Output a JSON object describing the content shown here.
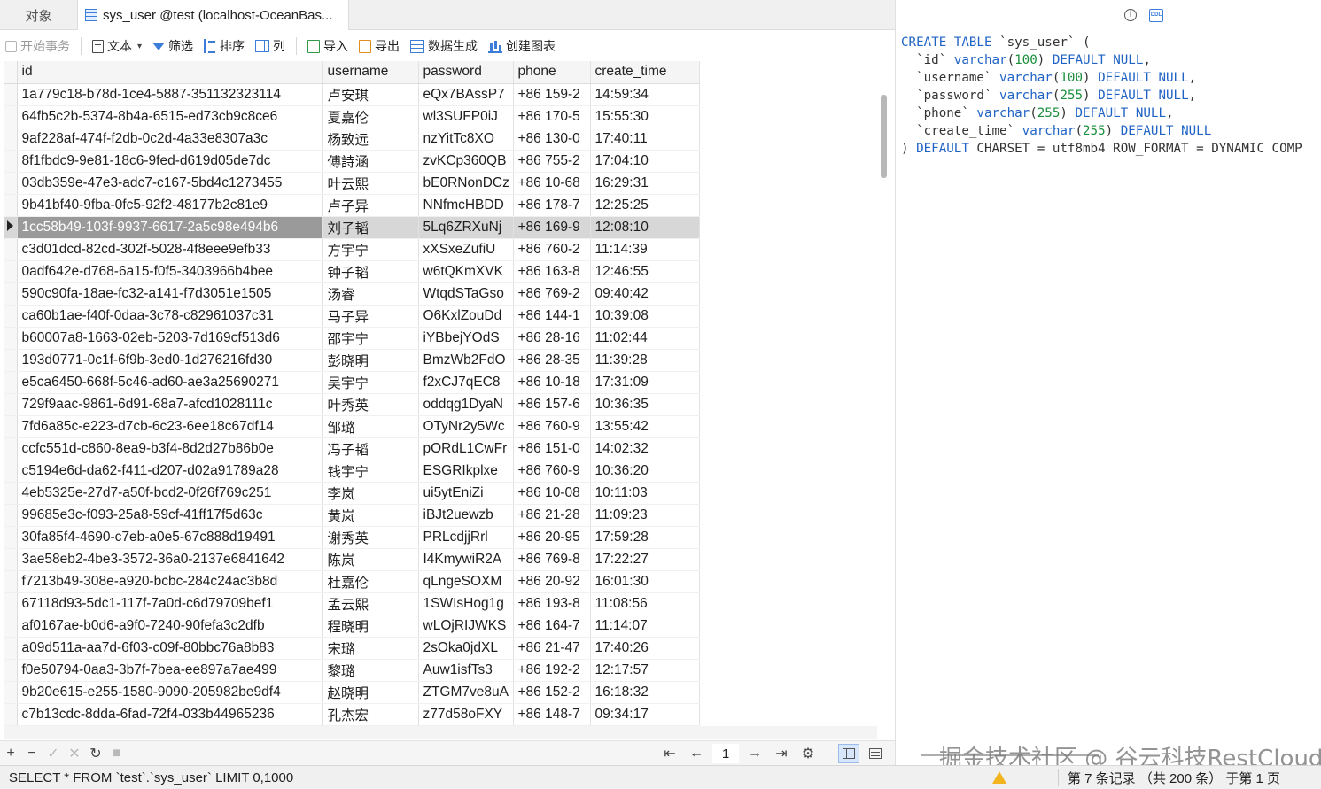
{
  "tabs": {
    "objects": "对象",
    "active": "sys_user @test (localhost-OceanBas..."
  },
  "toolbar": {
    "begin_transaction": "开始事务",
    "text": "文本",
    "filter": "筛选",
    "sort": "排序",
    "column": "列",
    "import": "导入",
    "export": "导出",
    "data_generation": "数据生成",
    "create_chart": "创建图表"
  },
  "grid": {
    "columns": [
      "id",
      "username",
      "password",
      "phone",
      "create_time"
    ],
    "selected_row_index": 6,
    "rows": [
      [
        "1a779c18-b78d-1ce4-5887-351132323114",
        "卢安琪",
        "eQx7BAssP7",
        "+86 159-2",
        "14:59:34"
      ],
      [
        "64fb5c2b-5374-8b4a-6515-ed73cb9c8ce6",
        "夏嘉伦",
        "wl3SUFP0iJ",
        "+86 170-5",
        "15:55:30"
      ],
      [
        "9af228af-474f-f2db-0c2d-4a33e8307a3c",
        "杨致远",
        "nzYitTc8XO",
        "+86 130-0",
        "17:40:11"
      ],
      [
        "8f1fbdc9-9e81-18c6-9fed-d619d05de7dc",
        "傅詩涵",
        "zvKCp360QB",
        "+86 755-2",
        "17:04:10"
      ],
      [
        "03db359e-47e3-adc7-c167-5bd4c1273455",
        "叶云熙",
        "bE0RNonDCz",
        "+86 10-68",
        "16:29:31"
      ],
      [
        "9b41bf40-9fba-0fc5-92f2-48177b2c81e9",
        "卢子异",
        "NNfmcHBDD",
        "+86 178-7",
        "12:25:25"
      ],
      [
        "1cc58b49-103f-9937-6617-2a5c98e494b6",
        "刘子韬",
        "5Lq6ZRXuNj",
        "+86 169-9",
        "12:08:10"
      ],
      [
        "c3d01dcd-82cd-302f-5028-4f8eee9efb33",
        "方宇宁",
        "xXSxeZufiU",
        "+86 760-2",
        "11:14:39"
      ],
      [
        "0adf642e-d768-6a15-f0f5-3403966b4bee",
        "钟子韬",
        "w6tQKmXVK",
        "+86 163-8",
        "12:46:55"
      ],
      [
        "590c90fa-18ae-fc32-a141-f7d3051e1505",
        "汤睿",
        "WtqdSTaGso",
        "+86 769-2",
        "09:40:42"
      ],
      [
        "ca60b1ae-f40f-0daa-3c78-c82961037c31",
        "马子异",
        "O6KxlZouDd",
        "+86 144-1",
        "10:39:08"
      ],
      [
        "b60007a8-1663-02eb-5203-7d169cf513d6",
        "邵宇宁",
        "iYBbejYOdS",
        "+86 28-16",
        "11:02:44"
      ],
      [
        "193d0771-0c1f-6f9b-3ed0-1d276216fd30",
        "彭晓明",
        "BmzWb2FdO",
        "+86 28-35",
        "11:39:28"
      ],
      [
        "e5ca6450-668f-5c46-ad60-ae3a25690271",
        "吴宇宁",
        "f2xCJ7qEC8",
        "+86 10-18",
        "17:31:09"
      ],
      [
        "729f9aac-9861-6d91-68a7-afcd1028111c",
        "叶秀英",
        "oddqg1DyaN",
        "+86 157-6",
        "10:36:35"
      ],
      [
        "7fd6a85c-e223-d7cb-6c23-6ee18c67df14",
        "邹璐",
        "OTyNr2y5Wc",
        "+86 760-9",
        "13:55:42"
      ],
      [
        "ccfc551d-c860-8ea9-b3f4-8d2d27b86b0e",
        "冯子韬",
        "pORdL1CwFr",
        "+86 151-0",
        "14:02:32"
      ],
      [
        "c5194e6d-da62-f411-d207-d02a91789a28",
        "钱宇宁",
        "ESGRIkplxe",
        "+86 760-9",
        "10:36:20"
      ],
      [
        "4eb5325e-27d7-a50f-bcd2-0f26f769c251",
        "李岚",
        "ui5ytEniZi",
        "+86 10-08",
        "10:11:03"
      ],
      [
        "99685e3c-f093-25a8-59cf-41ff17f5d63c",
        "黄岚",
        "iBJt2uewzb",
        "+86 21-28",
        "11:09:23"
      ],
      [
        "30fa85f4-4690-c7eb-a0e5-67c888d19491",
        "谢秀英",
        "PRLcdjjRrl",
        "+86 20-95",
        "17:59:28"
      ],
      [
        "3ae58eb2-4be3-3572-36a0-2137e6841642",
        "陈岚",
        "I4KmywiR2A",
        "+86 769-8",
        "17:22:27"
      ],
      [
        "f7213b49-308e-a920-bcbc-284c24ac3b8d",
        "杜嘉伦",
        "qLngeSOXM",
        "+86 20-92",
        "16:01:30"
      ],
      [
        "67118d93-5dc1-117f-7a0d-c6d79709bef1",
        "孟云熙",
        "1SWIsHog1g",
        "+86 193-8",
        "11:08:56"
      ],
      [
        "af0167ae-b0d6-a9f0-7240-90fefa3c2dfb",
        "程晓明",
        "wLOjRIJWKS",
        "+86 164-7",
        "11:14:07"
      ],
      [
        "a09d511a-aa7d-6f03-c09f-80bbc76a8b83",
        "宋璐",
        "2sOka0jdXL",
        "+86 21-47",
        "17:40:26"
      ],
      [
        "f0e50794-0aa3-3b7f-7bea-ee897a7ae499",
        "黎璐",
        "Auw1isfTs3",
        "+86 192-2",
        "12:17:57"
      ],
      [
        "9b20e615-e255-1580-9090-205982be9df4",
        "赵晓明",
        "ZTGM7ve8uA",
        "+86 152-2",
        "16:18:32"
      ],
      [
        "c7b13cdc-8dda-6fad-72f4-033b44965236",
        "孔杰宏",
        "z77d58oFXY",
        "+86 148-7",
        "09:34:17"
      ]
    ]
  },
  "nav": {
    "add": "+",
    "remove": "−",
    "apply": "✓",
    "discard": "✕",
    "refresh": "↻",
    "stop": "■",
    "first": "⇤",
    "prev": "←",
    "page": "1",
    "next": "→",
    "last": "⇥",
    "settings": "⚙"
  },
  "ddl": {
    "lines": [
      [
        [
          "kw",
          "CREATE TABLE"
        ],
        [
          "t",
          " `sys_user` ("
        ]
      ],
      [
        [
          "t",
          "  `id` "
        ],
        [
          "kw",
          "varchar"
        ],
        [
          "t",
          "("
        ],
        [
          "num",
          "100"
        ],
        [
          "t",
          ") "
        ],
        [
          "kw",
          "DEFAULT NULL"
        ],
        [
          "t",
          ","
        ]
      ],
      [
        [
          "t",
          "  `username` "
        ],
        [
          "kw",
          "varchar"
        ],
        [
          "t",
          "("
        ],
        [
          "num",
          "100"
        ],
        [
          "t",
          ") "
        ],
        [
          "kw",
          "DEFAULT NULL"
        ],
        [
          "t",
          ","
        ]
      ],
      [
        [
          "t",
          "  `password` "
        ],
        [
          "kw",
          "varchar"
        ],
        [
          "t",
          "("
        ],
        [
          "num",
          "255"
        ],
        [
          "t",
          ") "
        ],
        [
          "kw",
          "DEFAULT NULL"
        ],
        [
          "t",
          ","
        ]
      ],
      [
        [
          "t",
          "  `phone` "
        ],
        [
          "kw",
          "varchar"
        ],
        [
          "t",
          "("
        ],
        [
          "num",
          "255"
        ],
        [
          "t",
          ") "
        ],
        [
          "kw",
          "DEFAULT NULL"
        ],
        [
          "t",
          ","
        ]
      ],
      [
        [
          "t",
          "  `create_time` "
        ],
        [
          "kw",
          "varchar"
        ],
        [
          "t",
          "("
        ],
        [
          "num",
          "255"
        ],
        [
          "t",
          ") "
        ],
        [
          "kw",
          "DEFAULT NULL"
        ]
      ],
      [
        [
          "t",
          ") "
        ],
        [
          "kw",
          "DEFAULT"
        ],
        [
          "t",
          " CHARSET = utf8mb4 ROW_FORMAT = DYNAMIC COMP"
        ]
      ]
    ],
    "icon_label": "DDL"
  },
  "watermark": "掘金技术社区 @ 谷云科技RestCloud",
  "status": {
    "sql": "SELECT * FROM `test`.`sys_user` LIMIT 0,1000",
    "records": "第 7 条记录 （共 200 条） 于第 1 页"
  },
  "colors": {
    "keyword": "#1f63c4",
    "number": "#1a8f3c",
    "selected_row": "#d7d7d7",
    "selected_cell": "#9a9a9a"
  }
}
